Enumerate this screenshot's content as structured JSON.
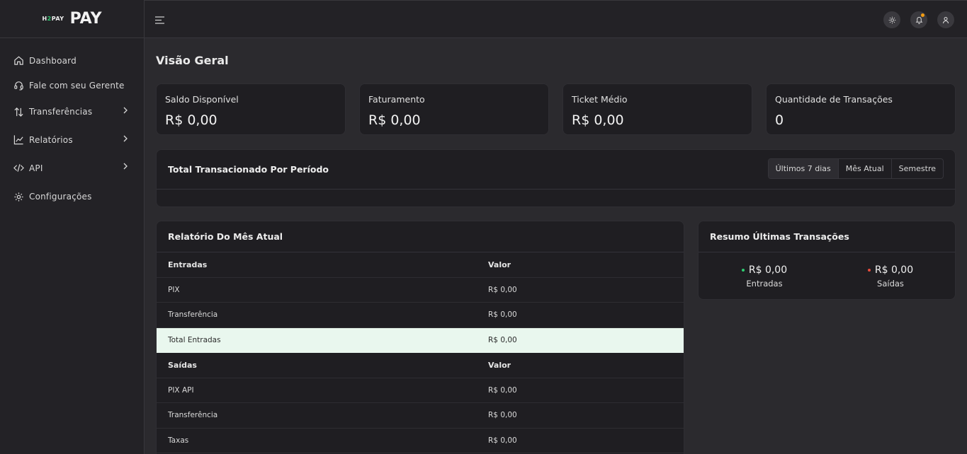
{
  "brand": {
    "small_prefix": "H",
    "small_highlight": "2",
    "small_suffix": "PAY",
    "name": "PAY"
  },
  "sidebar": {
    "items": [
      {
        "label": "Dashboard",
        "icon": "home-icon"
      },
      {
        "label": "Fale com seu Gerente",
        "icon": "headset-icon"
      },
      {
        "label": "Transferências",
        "icon": "transfer-arrows-icon"
      },
      {
        "label": "Relatórios",
        "icon": "chart-line-icon"
      },
      {
        "label": "API",
        "icon": "code-icon"
      },
      {
        "label": "Configurações",
        "icon": "gear-icon"
      }
    ]
  },
  "colors": {
    "accent_green": "#2ecc71",
    "accent_red": "#e74c3c",
    "notif": "#f39c12"
  },
  "page": {
    "title": "Visão Geral"
  },
  "stats": [
    {
      "label": "Saldo Disponível",
      "value": "R$ 0,00"
    },
    {
      "label": "Faturamento",
      "value": "R$ 0,00"
    },
    {
      "label": "Ticket Médio",
      "value": "R$ 0,00"
    },
    {
      "label": "Quantidade de Transações",
      "value": "0"
    }
  ],
  "period": {
    "title": "Total Transacionado Por Período",
    "options": [
      "Últimos 7 dias",
      "Mês Atual",
      "Semestre"
    ],
    "selected": "Últimos 7 dias"
  },
  "report": {
    "title": "Relatório Do Mês Atual",
    "rows": [
      {
        "c1": "Entradas",
        "c2": "Valor",
        "kind": "hdr"
      },
      {
        "c1": "PIX",
        "c2": "R$ 0,00",
        "kind": "row"
      },
      {
        "c1": "Transferência",
        "c2": "R$ 0,00",
        "kind": "row"
      },
      {
        "c1": "Total Entradas",
        "c2": "R$ 0,00",
        "kind": "total"
      },
      {
        "c1": "Saídas",
        "c2": "Valor",
        "kind": "hdr"
      },
      {
        "c1": "PIX API",
        "c2": "R$ 0,00",
        "kind": "row"
      },
      {
        "c1": "Transferência",
        "c2": "R$ 0,00",
        "kind": "row"
      },
      {
        "c1": "Taxas",
        "c2": "R$ 0,00",
        "kind": "row"
      }
    ]
  },
  "summary": {
    "title": "Resumo Últimas Transações",
    "entradas": {
      "value": "R$ 0,00",
      "label": "Entradas"
    },
    "saidas": {
      "value": "R$ 0,00",
      "label": "Saídas"
    }
  }
}
